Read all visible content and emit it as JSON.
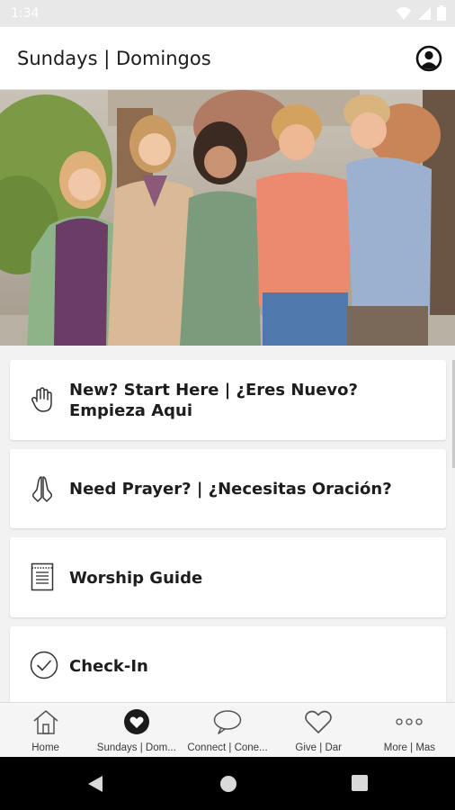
{
  "status_bar": {
    "time": "1:34"
  },
  "app_bar": {
    "title": "Sundays | Domingos"
  },
  "hero": {
    "description_alt": ""
  },
  "cards": [
    {
      "icon": "hand-wave-icon",
      "label": "New? Start Here | ¿Eres Nuevo? Empieza Aqui"
    },
    {
      "icon": "praying-hands-icon",
      "label": "Need Prayer? | ¿Necesitas Oración?"
    },
    {
      "icon": "document-guide-icon",
      "label": "Worship Guide"
    },
    {
      "icon": "check-circle-icon",
      "label": "Check-In"
    }
  ],
  "bottom_nav": {
    "items": [
      {
        "icon": "home-icon",
        "label": "Home",
        "active": false
      },
      {
        "icon": "heart-filled-circle-icon",
        "label": "Sundays | Dom...",
        "active": true
      },
      {
        "icon": "chat-bubble-icon",
        "label": "Connect | Cone...",
        "active": false
      },
      {
        "icon": "heart-outline-icon",
        "label": "Give | Dar",
        "active": false
      },
      {
        "icon": "more-dots-icon",
        "label": "More | Mas",
        "active": false
      }
    ]
  },
  "colors": {
    "accent": "#1b1b1b",
    "card_bg": "#ffffff",
    "page_bg": "#f2f2f2"
  }
}
